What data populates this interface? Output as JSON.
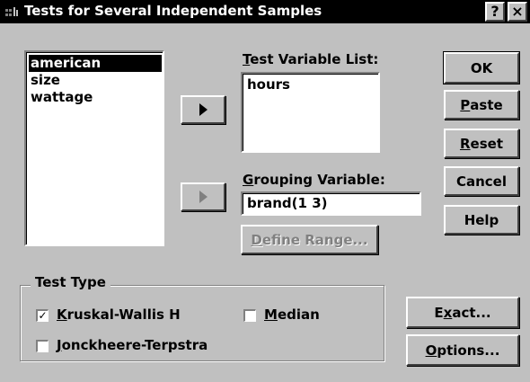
{
  "window": {
    "title": "Tests for Several Independent Samples",
    "help_btn": "?",
    "close_btn": "×"
  },
  "source_list": {
    "items": [
      {
        "label": "american",
        "selected": true
      },
      {
        "label": "size",
        "selected": false
      },
      {
        "label": "wattage",
        "selected": false
      }
    ]
  },
  "test_variable": {
    "label_pre": "",
    "label_key": "T",
    "label_post": "est Variable List:",
    "items": [
      "hours"
    ]
  },
  "grouping_variable": {
    "label_pre": "",
    "label_key": "G",
    "label_post": "rouping Variable:",
    "value": "brand(1 3)"
  },
  "define_range": {
    "pre": "",
    "key": "D",
    "post": "efine Range..."
  },
  "buttons": {
    "ok": {
      "pre": "OK",
      "key": "",
      "post": ""
    },
    "paste": {
      "pre": "",
      "key": "P",
      "post": "aste"
    },
    "reset": {
      "pre": "",
      "key": "R",
      "post": "eset"
    },
    "cancel": {
      "pre": "Cancel",
      "key": "",
      "post": ""
    },
    "help": {
      "pre": "Help",
      "key": "",
      "post": ""
    },
    "exact": {
      "pre": "E",
      "key": "x",
      "post": "act..."
    },
    "options": {
      "pre": "",
      "key": "O",
      "post": "ptions..."
    }
  },
  "test_type": {
    "title": "Test Type",
    "kruskal": {
      "pre": "",
      "key": "K",
      "post": "ruskal-Wallis H",
      "checked": true,
      "mark": "✓"
    },
    "median": {
      "pre": "",
      "key": "M",
      "post": "edian",
      "checked": false,
      "mark": ""
    },
    "jonckheere": {
      "pre": "",
      "key": "J",
      "post": "onckheere-Terpstra",
      "checked": false,
      "mark": ""
    }
  }
}
